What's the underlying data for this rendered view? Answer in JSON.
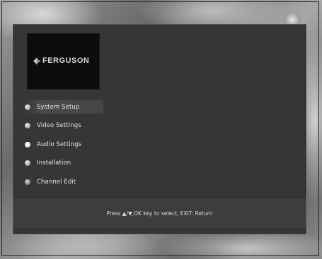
{
  "brand": {
    "logo_text": "FERGUSON",
    "logo_icon": "ferguson-logo-mark"
  },
  "menu": {
    "items": [
      {
        "label": "System Setup",
        "selected": true
      },
      {
        "label": "Video Settings",
        "selected": false
      },
      {
        "label": "Audio Settings",
        "selected": false
      },
      {
        "label": "Installation",
        "selected": false
      },
      {
        "label": "Channel Edit",
        "selected": false
      }
    ]
  },
  "help_bar": {
    "text": "Press ▲/▼,OK key to select, EXIT: Return"
  },
  "colors": {
    "panel_bg": "#363636",
    "logo_bg": "#0c0c0c",
    "text": "#e4e4e4"
  }
}
